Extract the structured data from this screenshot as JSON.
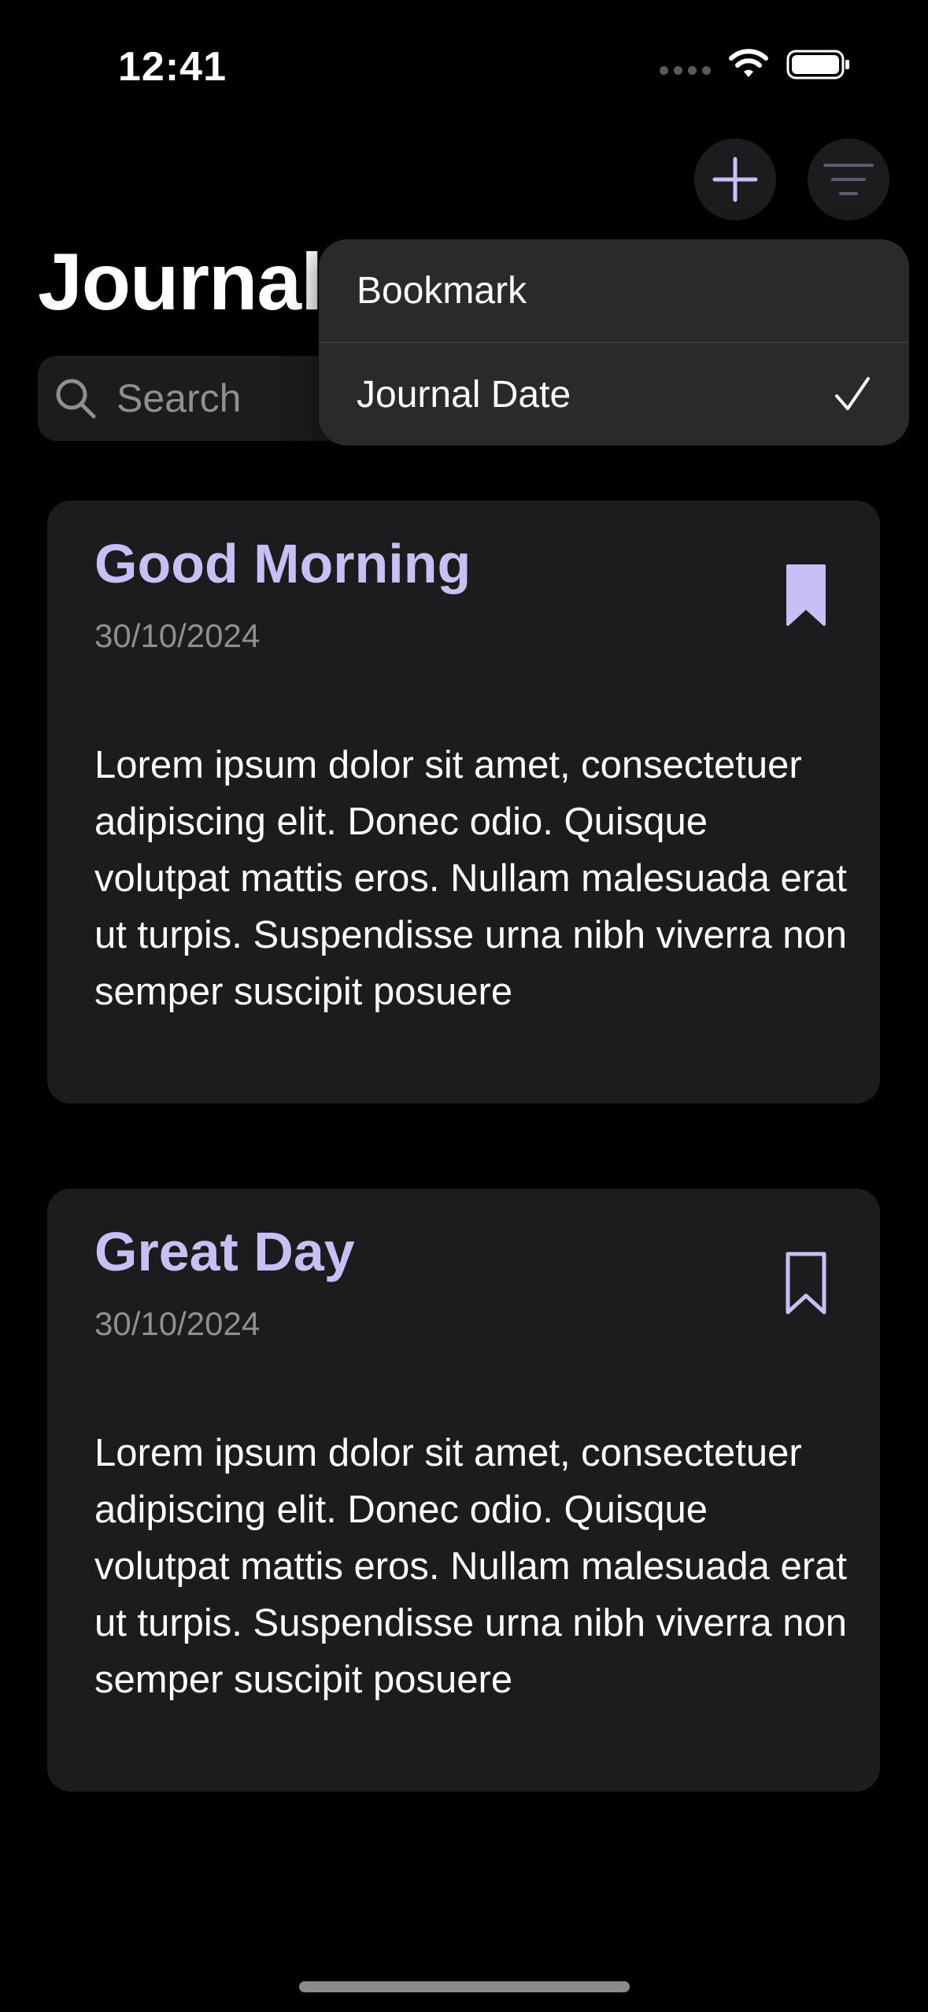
{
  "status_bar": {
    "time": "12:41"
  },
  "header": {
    "title": "Journal",
    "add_icon": "plus-icon",
    "filter_icon": "filter-lines-icon"
  },
  "search": {
    "placeholder": "Search",
    "value": ""
  },
  "sort_menu": {
    "items": [
      {
        "label": "Bookmark",
        "selected": false
      },
      {
        "label": "Journal Date",
        "selected": true
      }
    ]
  },
  "entries": [
    {
      "title": "Good Morning",
      "date": "30/10/2024",
      "bookmarked": true,
      "body": "Lorem ipsum dolor sit amet, consectetuer adipiscing elit. Donec odio. Quisque volutpat mattis eros. Nullam malesuada erat ut turpis. Suspendisse urna nibh viverra non semper suscipit posuere"
    },
    {
      "title": "Great Day",
      "date": "30/10/2024",
      "bookmarked": false,
      "body": "Lorem ipsum dolor sit amet, consectetuer adipiscing elit. Donec odio. Quisque volutpat mattis eros. Nullam malesuada erat ut turpis. Suspendisse urna nibh viverra non semper suscipit posuere"
    }
  ],
  "colors": {
    "background": "#000000",
    "card": "#1c1c1e",
    "accent": "#c8bff5",
    "secondary_text": "#8e8e93",
    "menu": "#2a2a2d"
  }
}
